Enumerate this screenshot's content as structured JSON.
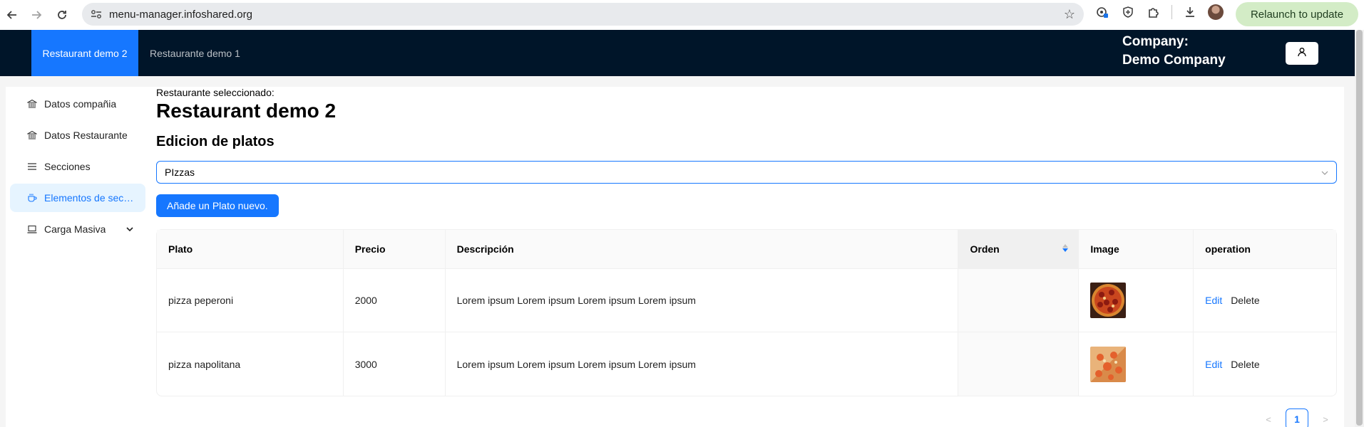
{
  "browser": {
    "url": "menu-manager.infoshared.org",
    "relaunch_label": "Relaunch to update"
  },
  "header": {
    "tabs": [
      {
        "label": "Restaurant demo 2",
        "active": true
      },
      {
        "label": "Restaurante demo 1",
        "active": false
      }
    ],
    "company_label": "Company:",
    "company_name": "Demo Company"
  },
  "sidebar": {
    "items": [
      {
        "label": "Datos compañia",
        "icon": "bank-icon"
      },
      {
        "label": "Datos Restaurante",
        "icon": "bank-icon"
      },
      {
        "label": "Secciones",
        "icon": "menu-icon"
      },
      {
        "label": "Elementos de secciones",
        "icon": "coffee-icon",
        "active": true
      },
      {
        "label": "Carga Masiva",
        "icon": "laptop-icon"
      }
    ]
  },
  "main": {
    "selected_label": "Restaurante seleccionado:",
    "restaurant_name": "Restaurant demo 2",
    "section_title": "Edicion de platos",
    "section_select_value": "PIzzas",
    "add_button_label": "Añade un Plato nuevo.",
    "table": {
      "columns": [
        "Plato",
        "Precio",
        "Descripción",
        "Orden",
        "Image",
        "operation"
      ],
      "rows": [
        {
          "plato": "pizza peperoni",
          "precio": "2000",
          "descripcion": "Lorem ipsum Lorem ipsum Lorem ipsum Lorem ipsum",
          "orden": "",
          "image": "pepperoni-pizza-image"
        },
        {
          "plato": "pizza napolitana",
          "precio": "3000",
          "descripcion": "Lorem ipsum Lorem ipsum Lorem ipsum Lorem ipsum",
          "orden": "",
          "image": "napolitana-pizza-image"
        }
      ],
      "edit_label": "Edit",
      "delete_label": "Delete"
    },
    "pagination": {
      "current_page": "1"
    }
  },
  "colors": {
    "header_bg": "#001529",
    "primary": "#1677ff",
    "active_menu_bg": "#e6f4ff",
    "relaunch_bg": "#d3ecc6"
  }
}
